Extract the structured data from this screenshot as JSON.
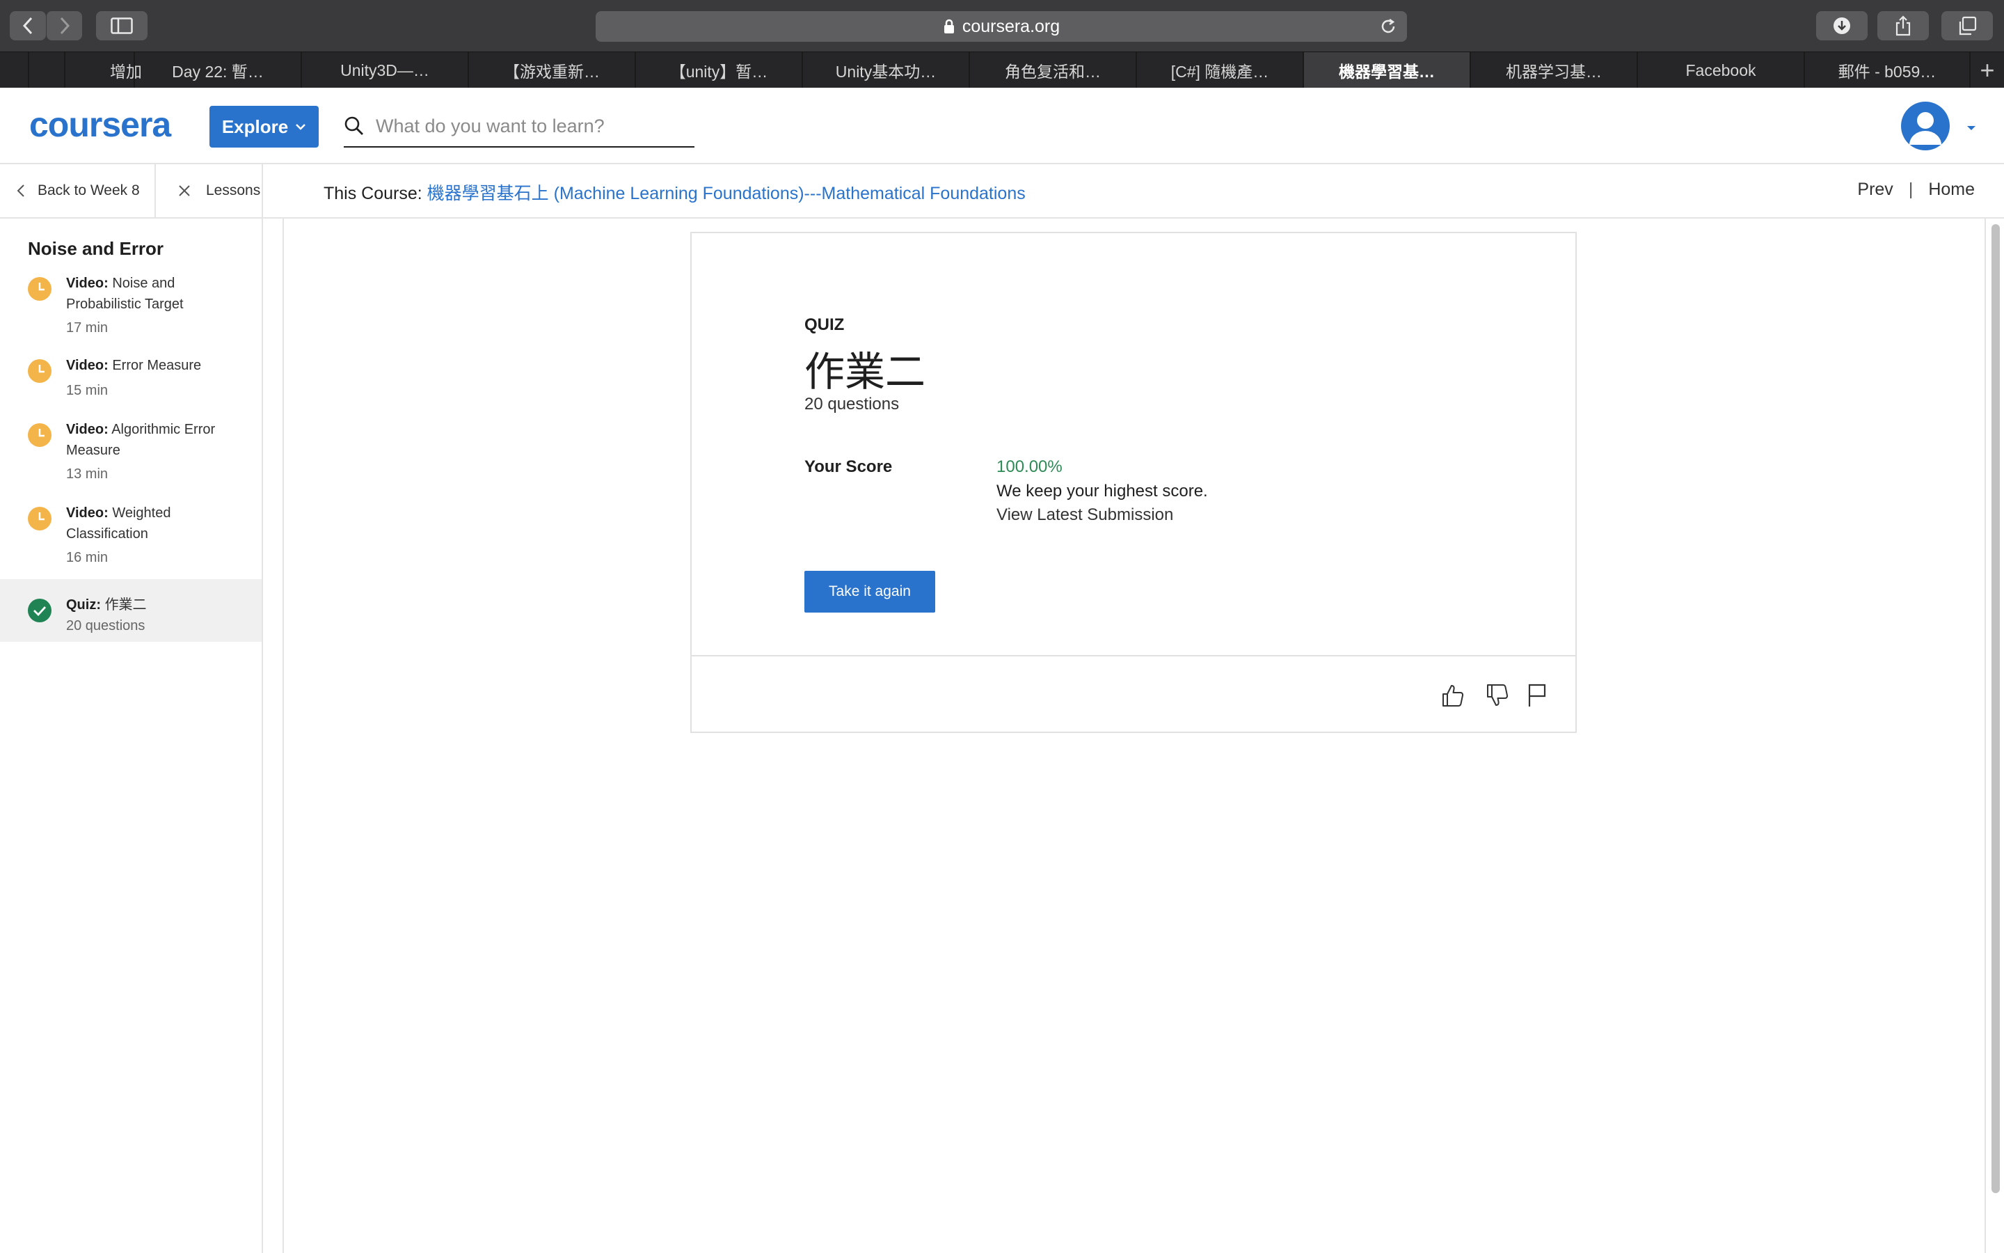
{
  "browser": {
    "url": "coursera.org",
    "tabs": [
      {
        "label": "增加",
        "active": false
      },
      {
        "label": "Day 22: 暫…",
        "active": false
      },
      {
        "label": "Unity3D—…",
        "active": false
      },
      {
        "label": "【游戏重新…",
        "active": false
      },
      {
        "label": "【unity】暂…",
        "active": false
      },
      {
        "label": "Unity基本功…",
        "active": false
      },
      {
        "label": "角色复活和…",
        "active": false
      },
      {
        "label": "[C#] 隨機產…",
        "active": false
      },
      {
        "label": "機器學習基…",
        "active": true
      },
      {
        "label": "机器学习基…",
        "active": false
      },
      {
        "label": "Facebook",
        "active": false
      },
      {
        "label": "郵件 - b059…",
        "active": false
      }
    ],
    "new_tab_label": "+"
  },
  "header": {
    "logo": "coursera",
    "explore_label": "Explore",
    "search_placeholder": "What do you want to learn?"
  },
  "subheader": {
    "back_label": "Back to Week 8",
    "lessons_label": "Lessons",
    "course_prefix": "This Course: ",
    "course_name": "機器學習基石上 (Machine Learning Foundations)---Mathematical Foundations",
    "prev_label": "Prev",
    "separator": "|",
    "home_label": "Home"
  },
  "sidebar": {
    "title": "Noise and Error",
    "items": [
      {
        "kind": "Video:",
        "title": "Noise and Probabilistic Target",
        "meta": "17 min",
        "status": "clock-icon"
      },
      {
        "kind": "Video:",
        "title": "Error Measure",
        "meta": "15 min",
        "status": "clock-icon"
      },
      {
        "kind": "Video:",
        "title": "Algorithmic Error Measure",
        "meta": "13 min",
        "status": "clock-icon"
      },
      {
        "kind": "Video:",
        "title": "Weighted Classification",
        "meta": "16 min",
        "status": "clock-icon"
      },
      {
        "kind": "Quiz:",
        "title": "作業二",
        "meta": "20 questions",
        "status": "check-circle-icon"
      }
    ]
  },
  "quiz": {
    "label": "QUIZ",
    "title": "作業二",
    "question_count": "20 questions",
    "score_label": "Your Score",
    "score_value": "100.00%",
    "score_note": "We keep your highest score.",
    "view_latest": "View Latest Submission",
    "take_again": "Take it again"
  },
  "colors": {
    "brand": "#2a73cc",
    "score_green": "#2e8b57",
    "pending_orange": "#f3b54a",
    "complete_green": "#1f8354"
  }
}
